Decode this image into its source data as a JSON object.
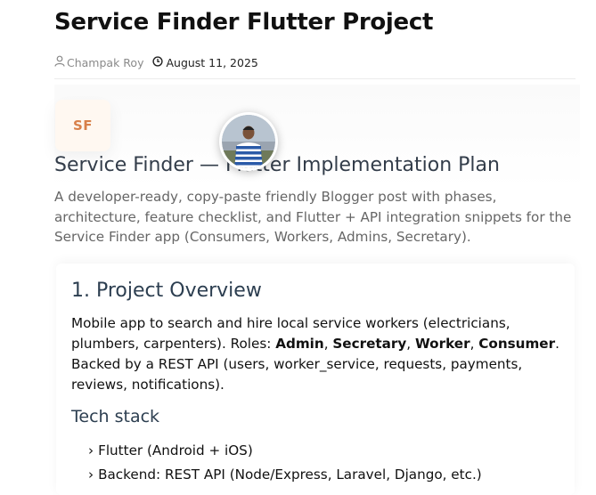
{
  "post": {
    "title": "Service Finder Flutter Project",
    "author": "Champak Roy",
    "date": "August 11, 2025"
  },
  "hero": {
    "logo_text": "SF",
    "heading": "Service Finder — Flutter Implementation Plan",
    "description": "A developer-ready, copy-paste friendly Blogger post with phases, architecture, feature checklist, and Flutter + API integration snippets for the Service Finder app (Consumers, Workers, Admins, Secretary)."
  },
  "section1": {
    "heading": "1. Project Overview",
    "p_intro": "Mobile app to search and hire local service workers (electricians, plumbers, carpenters). Roles: ",
    "role_admin": "Admin",
    "sep1": ", ",
    "role_secretary": "Secretary",
    "sep2": ", ",
    "role_worker": "Worker",
    "sep3": ", ",
    "role_consumer": "Consumer",
    "p_outro": ". Backed by a REST API (users, worker_service, requests, payments, reviews, notifications).",
    "tech_heading": "Tech stack",
    "bullet": "›",
    "tech_items": [
      "Flutter (Android + iOS)",
      "Backend: REST API (Node/Express, Laravel, Django, etc.)"
    ]
  },
  "icons": {
    "author": "user-outline-icon",
    "date": "clock-icon"
  }
}
